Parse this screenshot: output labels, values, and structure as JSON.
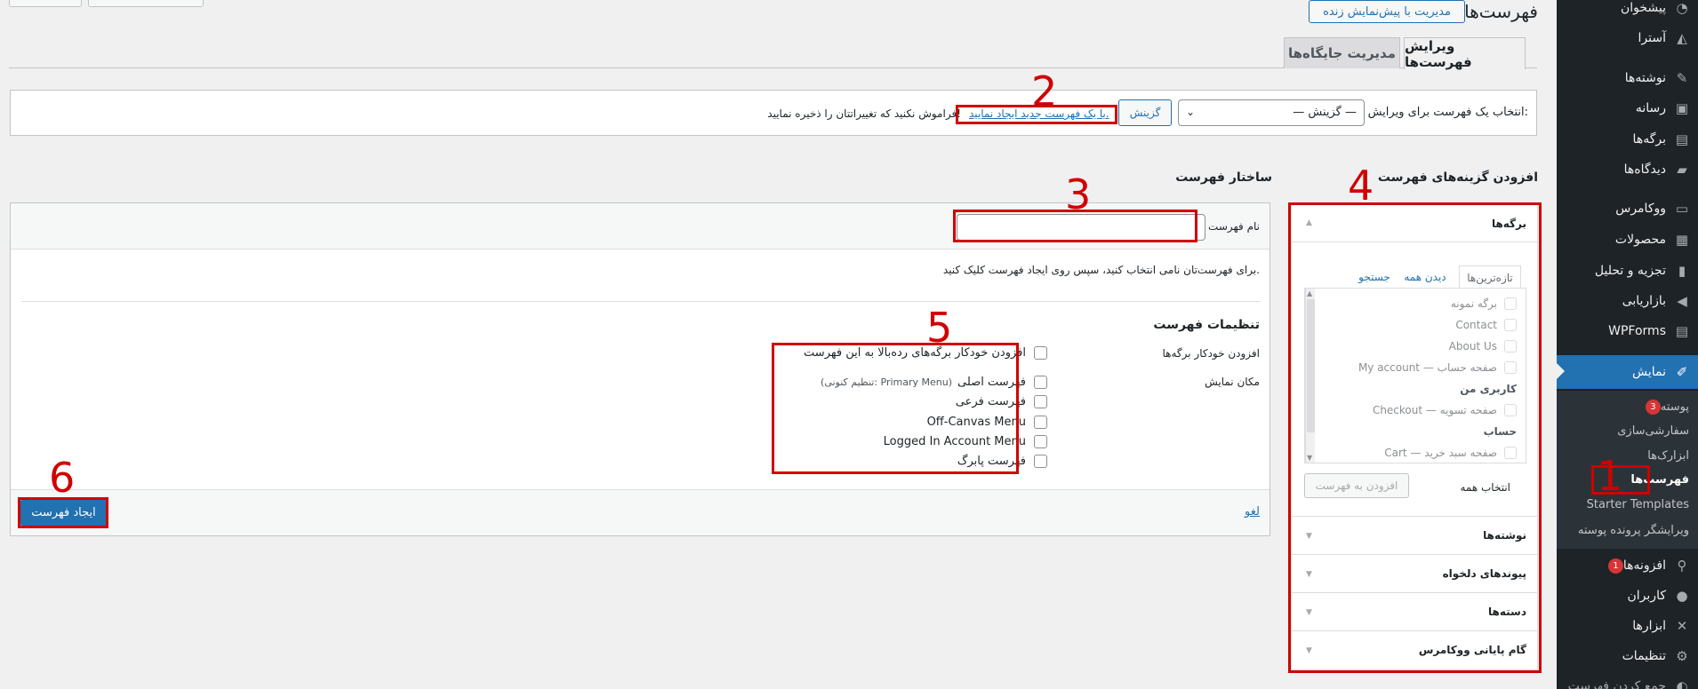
{
  "sidebar": {
    "items": [
      {
        "label": "پیشخوان",
        "icon": "dashboard-icon"
      },
      {
        "label": "آسترا",
        "icon": "astra-icon"
      },
      {
        "label": "نوشته‌ها",
        "icon": "pin-icon"
      },
      {
        "label": "رسانه",
        "icon": "media-icon"
      },
      {
        "label": "برگه‌ها",
        "icon": "pages-icon"
      },
      {
        "label": "دیدگاه‌ها",
        "icon": "comments-icon"
      },
      {
        "label": "ووکامرس",
        "icon": "woocommerce-icon"
      },
      {
        "label": "محصولات",
        "icon": "products-icon"
      },
      {
        "label": "تجزیه و تحلیل",
        "icon": "analytics-icon"
      },
      {
        "label": "بازاریابی",
        "icon": "megaphone-icon"
      },
      {
        "label": "WPForms",
        "icon": "wpforms-icon"
      },
      {
        "label": "نمایش",
        "icon": "appearance-icon"
      }
    ],
    "appearance_submenu": [
      {
        "label": "پوسته",
        "badge": "3"
      },
      {
        "label": "سفارشی‌سازی"
      },
      {
        "label": "ابزارک‌ها"
      },
      {
        "label": "فهرست‌ها"
      },
      {
        "label": "Starter Templates"
      },
      {
        "label": "ویرایشگر پرونده پوسته"
      }
    ],
    "bottom_items": [
      {
        "label": "افزونه‌ها",
        "icon": "plugins-icon",
        "badge": "1"
      },
      {
        "label": "کاربران",
        "icon": "users-icon"
      },
      {
        "label": "ابزارها",
        "icon": "tools-icon"
      },
      {
        "label": "تنظیمات",
        "icon": "settings-icon"
      },
      {
        "label": "جمع کردن فهرست"
      }
    ]
  },
  "header": {
    "title": "فهرست‌ها",
    "live_preview_button": "مدیریت با پیش‌نمایش زنده"
  },
  "tabs": [
    {
      "label": "ویرایش فهرست‌ها"
    },
    {
      "label": "مدیریت جایگاه‌ها"
    }
  ],
  "select_bar": {
    "label": "انتخاب یک فهرست برای ویرایش:",
    "select_value": "— گزینش —",
    "select_button": "گزینش",
    "create_link": "یا یک فهرست جدید ایجاد نمایید.",
    "reminder": "فراموش نکنید که تغییراتتان را ذخیره نمایید!"
  },
  "add_items": {
    "heading": "افزودن گزینه‌های فهرست",
    "pages_section": "برگه‌ها",
    "inner_tabs": [
      "تازه‌ترین‌ها",
      "دیدن همه",
      "جستجو"
    ],
    "page_items": [
      "برگه نمونه",
      "Contact",
      "About Us",
      "My account — صفحه حساب",
      "کاربری من",
      "Checkout — صفحه تسویه",
      "حساب",
      "Cart — صفحه سبد خرید"
    ],
    "select_all": "انتخاب همه",
    "add_to_menu": "افزودن به فهرست",
    "other_sections": [
      "نوشته‌ها",
      "پیوندهای دلخواه",
      "دسته‌ها",
      "گام پایانی ووکامرس"
    ]
  },
  "structure": {
    "heading": "ساختار فهرست",
    "menu_name_label": "نام فهرست",
    "menu_name_value": "",
    "instructions": "برای فهرست‌تان نامی انتخاب کنید، سپس روی ایجاد فهرست کلیک کنید.",
    "settings_heading": "تنظیمات فهرست",
    "auto_add_label": "افزودن خودکار برگه‌ها",
    "auto_add_option": "افزودن خودکار برگه‌های رده‌بالا به این فهرست",
    "display_location_label": "مکان نمایش",
    "locations": [
      {
        "label": "فهرست اصلی",
        "note": "(تنظیم کنونی: Primary Menu)"
      },
      {
        "label": "فهرست فرعی",
        "note": ""
      },
      {
        "label": "Off-Canvas Menu",
        "note": ""
      },
      {
        "label": "Logged In Account Menu",
        "note": ""
      },
      {
        "label": "فهرست پابرگ",
        "note": ""
      }
    ],
    "cancel_link": "لغو",
    "create_button": "ایجاد فهرست"
  },
  "annotations": [
    "1",
    "2",
    "3",
    "4",
    "5",
    "6"
  ],
  "colors": {
    "admin_bar": "#1d2327",
    "accent": "#2271b1",
    "annotation": "#d00000"
  }
}
